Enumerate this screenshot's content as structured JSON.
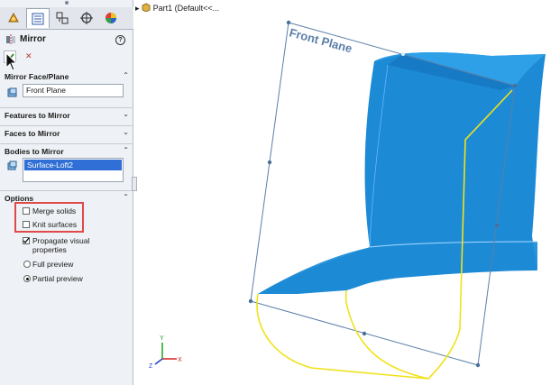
{
  "tabs": [
    {
      "name": "feature-manager-tab",
      "icon": "feature-tree-icon"
    },
    {
      "name": "property-manager-tab",
      "icon": "property-list-icon"
    },
    {
      "name": "configuration-manager-tab",
      "icon": "configuration-icon"
    },
    {
      "name": "dimxpert-tab",
      "icon": "crosshair-icon"
    },
    {
      "name": "display-manager-tab",
      "icon": "appearance-sphere-icon"
    }
  ],
  "header": {
    "title": "Mirror",
    "help": "?"
  },
  "actions": {
    "ok_icon": "checkmark-icon",
    "cancel_icon": "close-icon",
    "cancel_color": "#c0392b"
  },
  "mirror_face": {
    "label": "Mirror Face/Plane",
    "value": "Front Plane"
  },
  "features": {
    "label": "Features to Mirror"
  },
  "faces": {
    "label": "Faces to Mirror"
  },
  "bodies": {
    "label": "Bodies to Mirror",
    "selected": "Surface-Loft2"
  },
  "options": {
    "label": "Options",
    "merge_solids": "Merge solids",
    "knit_surfaces": "Knit surfaces",
    "propagate_line1": "Propagate visual",
    "propagate_line2": "properties",
    "full_preview": "Full preview",
    "partial_preview": "Partial preview"
  },
  "tree": {
    "part": "Part1  (Default<<..."
  },
  "viewport": {
    "plane_label": "Front Plane",
    "surface_color": "#1f8fd8",
    "preview_color": "#f0e21a",
    "axis_x": "X",
    "axis_y": "Y",
    "axis_z": "Z"
  }
}
